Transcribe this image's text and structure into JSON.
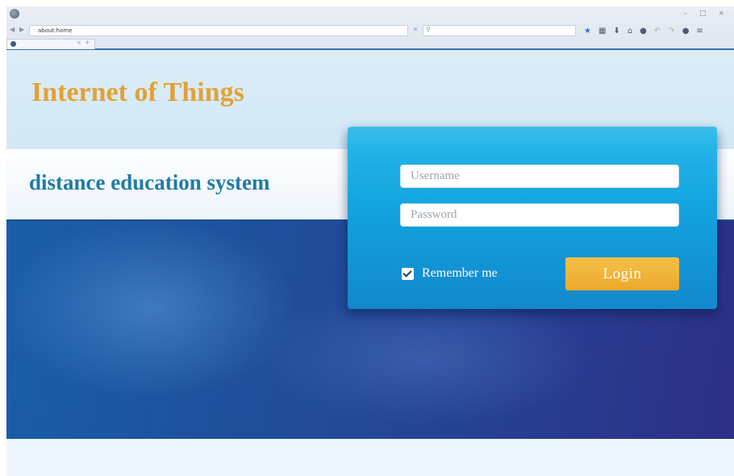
{
  "browser": {
    "url": "about:home",
    "search_placeholder": "",
    "tab_title": "",
    "window_controls": {
      "minimize": "–",
      "maximize": "□",
      "close": "×"
    },
    "icons": [
      "back-icon",
      "forward-icon",
      "search-icon",
      "bookmark-star-icon",
      "bookmarks-icon",
      "downloads-icon",
      "home-icon",
      "pocket-icon",
      "undo-icon",
      "redo-icon",
      "chat-icon",
      "menu-icon"
    ]
  },
  "page": {
    "site_title": "Internet of Things",
    "site_subtitle": "distance education system",
    "login": {
      "username_placeholder": "Username",
      "password_placeholder": "Password",
      "remember_label": "Remember me",
      "remember_checked": true,
      "login_button": "Login"
    }
  },
  "colors": {
    "title": "#e3a135",
    "subtitle": "#1f7ba7",
    "panel": "#12a3df",
    "button": "#f0b53a",
    "hero": "#1f4f9c"
  }
}
